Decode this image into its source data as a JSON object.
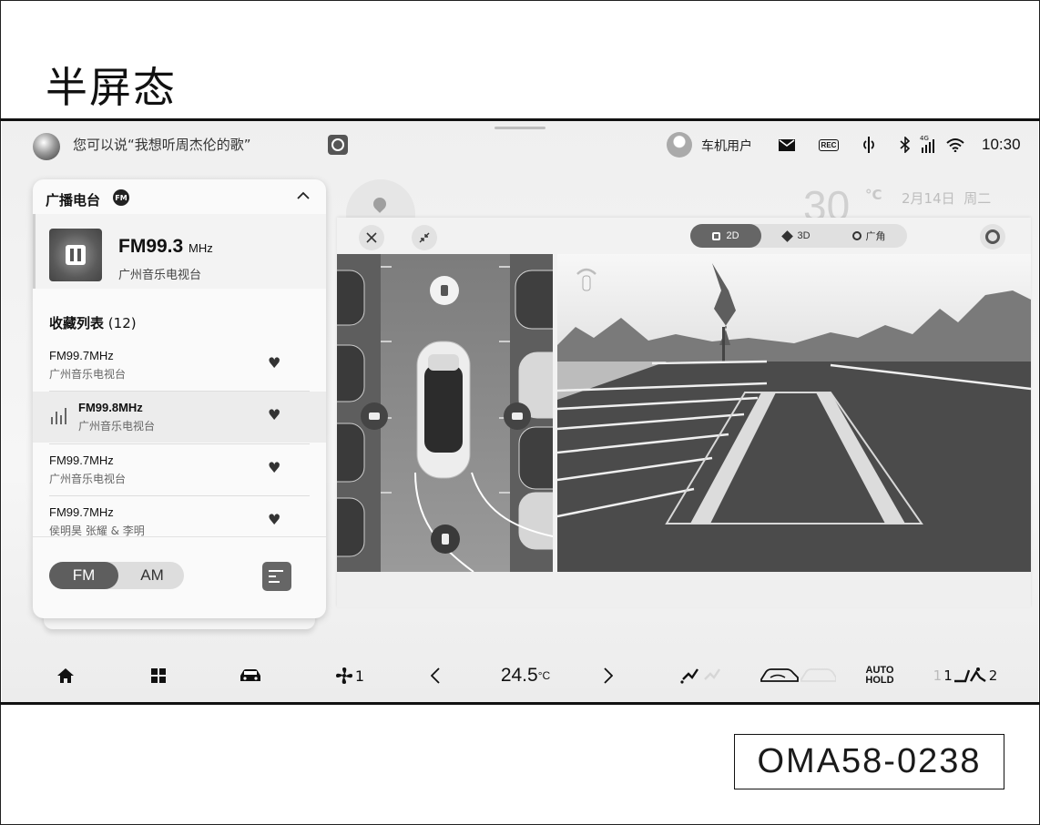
{
  "document": {
    "title": "半屏态",
    "figure_code": "OMA58-0238"
  },
  "status_bar": {
    "assistant_hint": "您可以说“我想听周杰伦的歌”",
    "user_name": "车机用户",
    "rec_label": "REC",
    "network_label": "4G",
    "time": "10:30"
  },
  "radio": {
    "title": "广播电台",
    "badge": "FM",
    "now_playing": {
      "frequency": "FM99.3",
      "unit": "MHz",
      "station": "广州音乐电视台"
    },
    "favorites_label": "收藏列表",
    "favorites_count": "(12)",
    "favorites": [
      {
        "frequency": "FM99.7MHz",
        "station": "广州音乐电视台",
        "active": false
      },
      {
        "frequency": "FM99.8MHz",
        "station": "广州音乐电视台",
        "active": true
      },
      {
        "frequency": "FM99.7MHz",
        "station": "广州音乐电视台",
        "active": false
      },
      {
        "frequency": "FM99.7MHz",
        "station": "侯明昊 张耀 & 李明",
        "active": false
      }
    ],
    "band_fm": "FM",
    "band_am": "AM"
  },
  "background_widget": {
    "temperature": "30",
    "temp_unit": "°C",
    "date": "2月14日",
    "weekday": "周二"
  },
  "camera": {
    "modes": [
      {
        "label": "2D",
        "active": true
      },
      {
        "label": "3D",
        "active": false
      },
      {
        "label": "广角",
        "active": false
      }
    ]
  },
  "dock": {
    "fan_level": "1",
    "temperature": "24.5",
    "temp_unit": "°C",
    "auto_hold": "AUTO\nHOLD",
    "seat_left": "1",
    "seat_right": "2"
  },
  "icons": [
    "assistant-orb-icon",
    "cast-icon",
    "user-avatar-icon",
    "mail-icon",
    "rec-icon",
    "phone-signal-icon",
    "bluetooth-icon",
    "cellular-icon",
    "wifi-icon",
    "collapse-icon",
    "pause-icon",
    "heart-icon",
    "favorites-list-icon",
    "close-icon",
    "shrink-icon",
    "settings-icon",
    "home-icon",
    "apps-icon",
    "car-icon",
    "fan-icon",
    "left-arrow-icon",
    "right-arrow-icon",
    "airflow-icon",
    "recirculation-icon",
    "seat-heat-icon"
  ]
}
